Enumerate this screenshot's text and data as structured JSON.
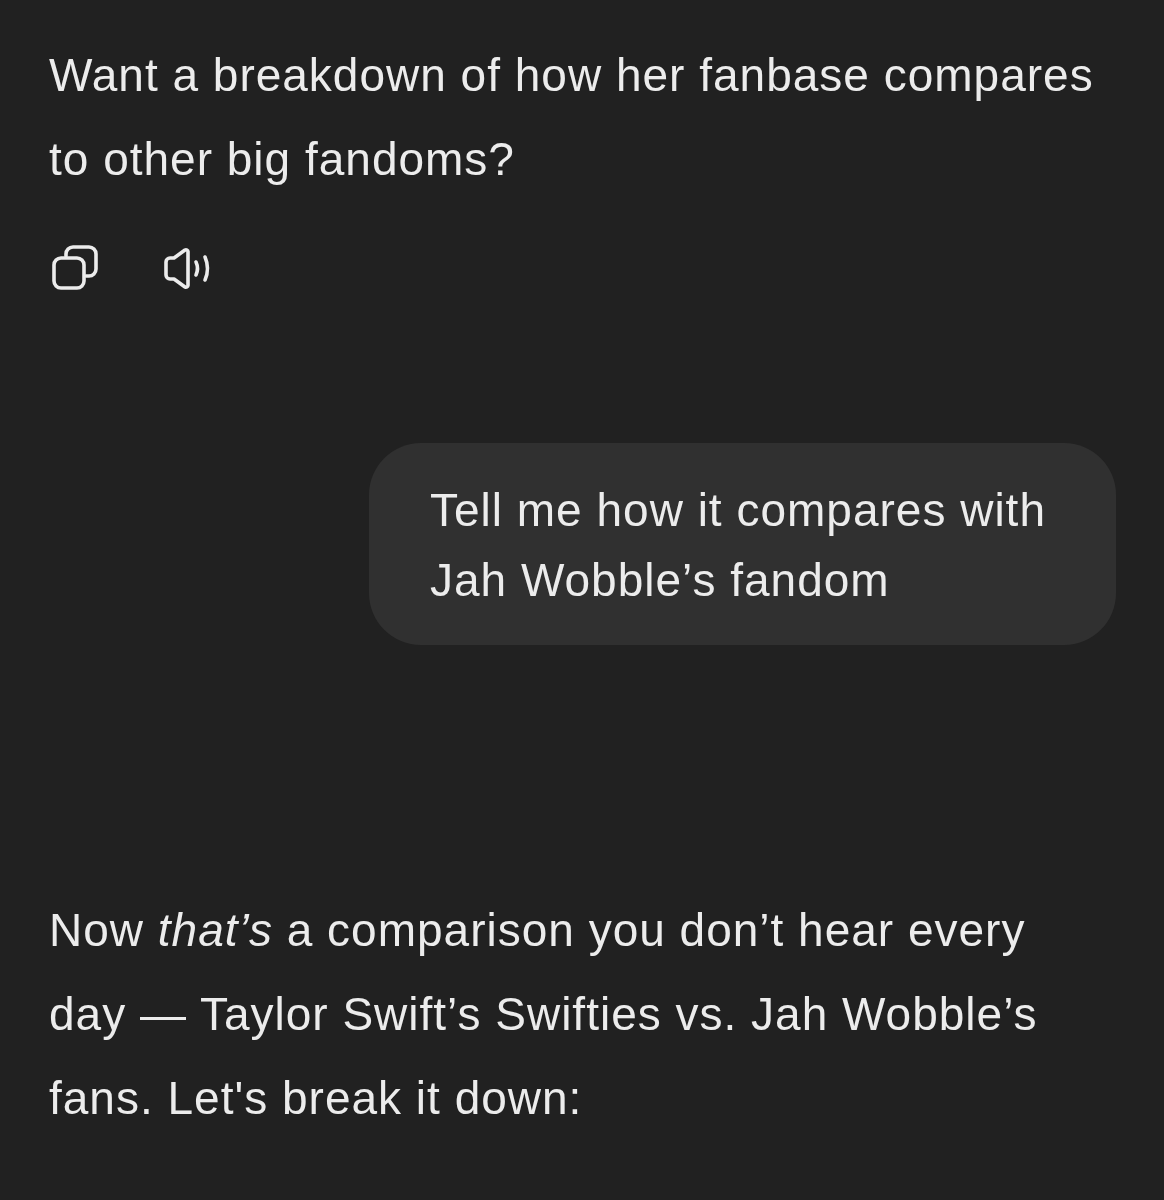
{
  "previous_reply": {
    "text": "Want a breakdown of how her fanbase compares to other big fandoms?"
  },
  "user_message": {
    "text": "Tell me how it compares with Jah Wobble’s fandom"
  },
  "reply": {
    "text": "Now *that’s* a comparison you don’t hear every day — Taylor Swift’s Swifties vs. Jah Wobble’s fans. Let's break it down:"
  }
}
